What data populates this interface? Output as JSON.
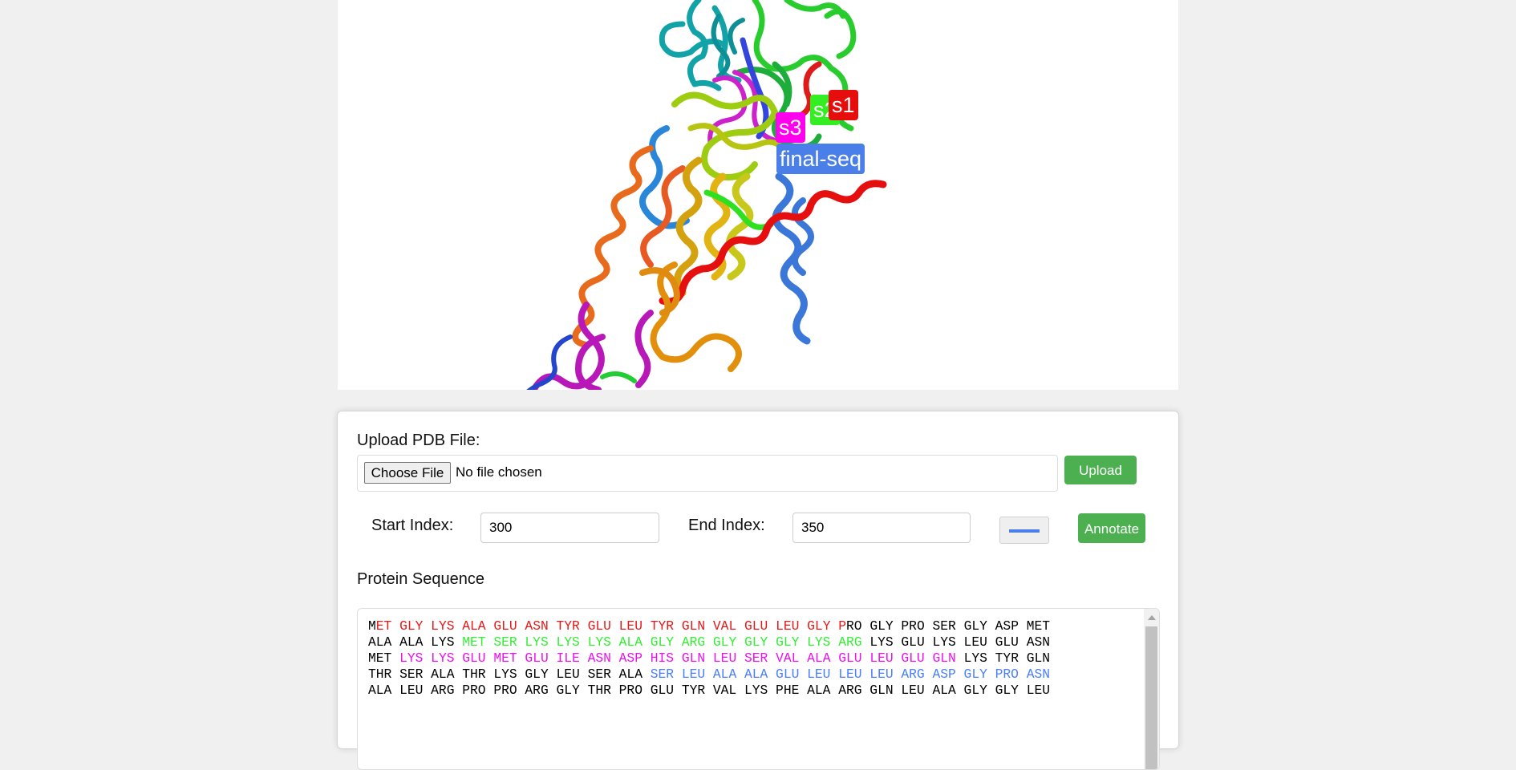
{
  "viewer": {
    "labels": [
      {
        "text": "final-seq",
        "color": "#4a7ee8"
      },
      {
        "text": "s3",
        "color": "#ff00ee"
      },
      {
        "text": "s2",
        "color": "#33ee22"
      },
      {
        "text": "s1",
        "color": "#e60d0d"
      }
    ]
  },
  "upload": {
    "label": "Upload PDB File:",
    "choose_file_label": "Choose File",
    "file_status": "No file chosen",
    "upload_button": "Upload"
  },
  "annotate": {
    "start_label": "Start Index:",
    "start_value": "300",
    "end_label": "End Index:",
    "end_value": "350",
    "color_value": "#4a7ee8",
    "annotate_button": "Annotate"
  },
  "sequence": {
    "title": "Protein Sequence",
    "colors": {
      "black": "#000000",
      "red": "#e61919",
      "green": "#33ee33",
      "magenta": "#ee11ee",
      "blue": "#4a7eff"
    },
    "lines": [
      [
        {
          "t": "M",
          "c": "black"
        },
        {
          "t": "ET GLY LYS ALA GLU ASN TYR GLU LEU TYR GLN VAL GLU LEU GLY P",
          "c": "red"
        },
        {
          "t": "RO GLY PRO SER GLY ASP MET",
          "c": "black"
        }
      ],
      [
        {
          "t": "ALA ALA LYS ",
          "c": "black"
        },
        {
          "t": "MET SER LYS LYS LYS ALA GLY ARG GLY GLY GLY LYS ARG",
          "c": "green"
        },
        {
          "t": " LYS GLU LYS LEU GLU ASN",
          "c": "black"
        }
      ],
      [
        {
          "t": "MET ",
          "c": "black"
        },
        {
          "t": "LYS LYS GLU MET GLU ILE ASN ASP HIS GLN LEU SER VAL ALA GLU LEU GLU GLN",
          "c": "magenta"
        },
        {
          "t": " LYS TYR GLN",
          "c": "black"
        }
      ],
      [
        {
          "t": "THR SER ALA THR LYS GLY LEU SER ALA ",
          "c": "black"
        },
        {
          "t": "SER LEU ALA ALA GLU LEU LEU LEU ARG ASP GLY PRO ASN",
          "c": "blue"
        }
      ],
      [
        {
          "t": "ALA LEU ARG PRO PRO ARG GLY THR PRO GLU TYR VAL LYS PHE ALA ARG GLN LEU ALA GLY GLY LEU",
          "c": "black"
        }
      ]
    ]
  }
}
